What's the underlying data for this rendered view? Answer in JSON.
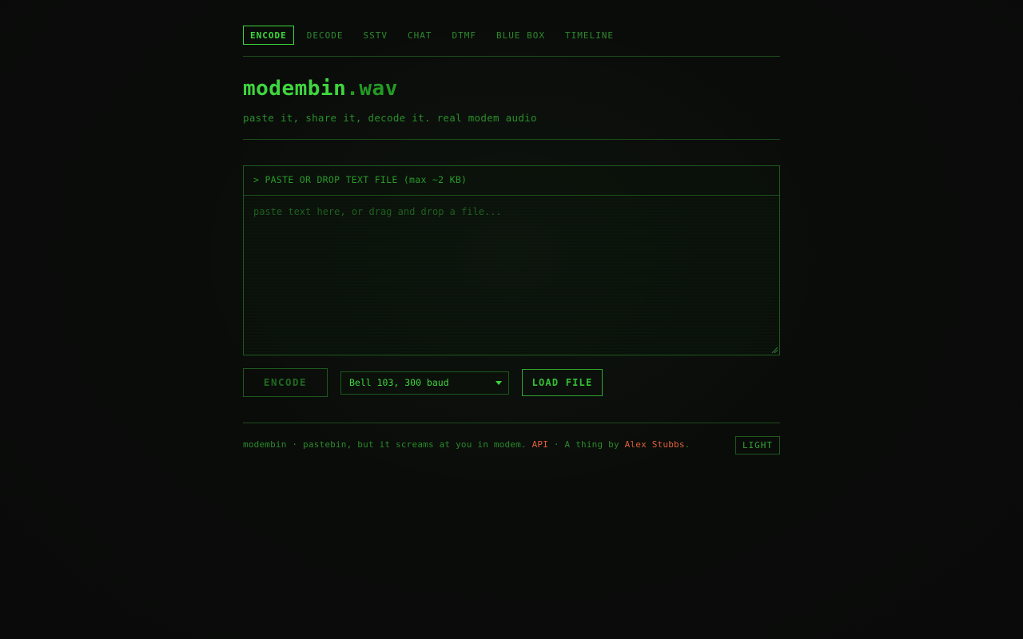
{
  "nav": {
    "tabs": [
      {
        "label": "ENCODE",
        "active": true
      },
      {
        "label": "DECODE",
        "active": false
      },
      {
        "label": "SSTV",
        "active": false
      },
      {
        "label": "CHAT",
        "active": false
      },
      {
        "label": "DTMF",
        "active": false
      },
      {
        "label": "BLUE BOX",
        "active": false
      },
      {
        "label": "TIMELINE",
        "active": false
      }
    ]
  },
  "header": {
    "title_main": "modembin",
    "title_ext": ".wav",
    "subtitle": "paste it, share it, decode it. real modem audio"
  },
  "paste": {
    "header": "> PASTE OR DROP TEXT FILE (max ~2 KB)",
    "value": "",
    "placeholder": "paste text here, or drag and drop a file..."
  },
  "controls": {
    "encode_label": "ENCODE",
    "encode_disabled": true,
    "mode_selected": "Bell 103, 300 baud",
    "load_label": "LOAD FILE"
  },
  "footer": {
    "text_before": "modembin · pastebin, but it screams at you in modem. ",
    "api_link": "API",
    "text_middle": " · A thing by ",
    "author_link": "Alex Stubbs",
    "text_after": ".",
    "theme_toggle": "LIGHT"
  },
  "colors": {
    "accent": "#3ed63e",
    "dim": "#2a8f2a",
    "link": "#e0603a",
    "background": "#0a0b0a"
  }
}
